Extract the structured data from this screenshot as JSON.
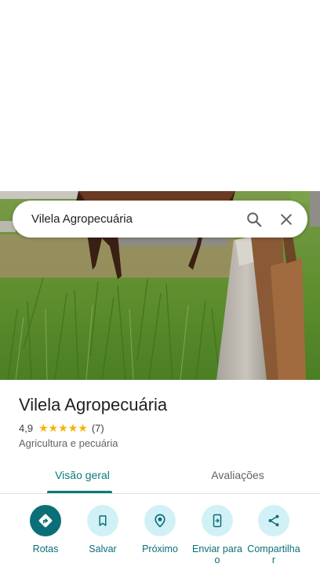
{
  "search": {
    "query": "Vilela Agropecuária"
  },
  "place": {
    "name": "Vilela Agropecuária",
    "rating": "4,9",
    "stars": "★★★★★",
    "review_count": "(7)",
    "category": "Agricultura e pecuária"
  },
  "tabs": [
    {
      "label": "Visão geral",
      "selected": true
    },
    {
      "label": "Avaliações",
      "selected": false
    }
  ],
  "actions": [
    {
      "label": "Rotas",
      "icon": "directions-icon"
    },
    {
      "label": "Salvar",
      "icon": "bookmark-icon"
    },
    {
      "label": "Próximo",
      "icon": "nearby-icon"
    },
    {
      "label": "Enviar para o",
      "icon": "send-to-phone-icon"
    },
    {
      "label": "Compartilhar",
      "icon": "share-icon"
    }
  ],
  "colors": {
    "accent": "#0b6f78",
    "star": "#f4b400"
  }
}
